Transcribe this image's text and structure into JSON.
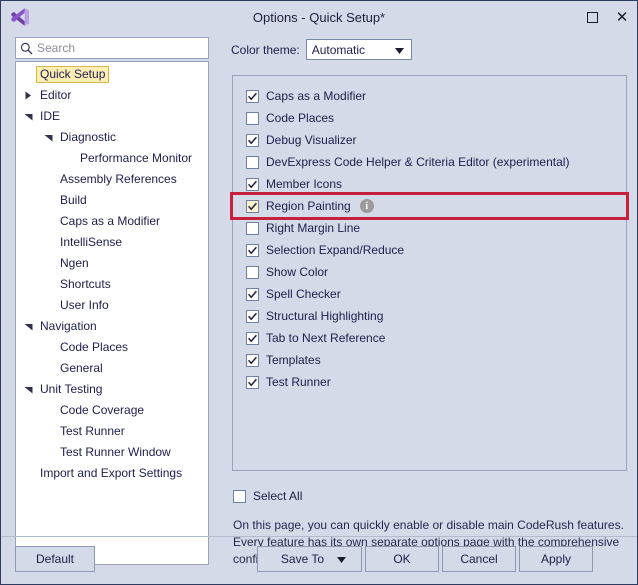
{
  "window": {
    "title": "Options - Quick Setup*",
    "logo_icon": "visual-studio-logo",
    "maximize_label": "Maximize",
    "close_label": "Close"
  },
  "search": {
    "placeholder": "Search",
    "value": "",
    "icon": "search-icon"
  },
  "tree": {
    "items": [
      {
        "label": "Quick Setup",
        "indent": 0,
        "arrow": "none",
        "selected": true
      },
      {
        "label": "Editor",
        "indent": 0,
        "arrow": "collapsed",
        "selected": false
      },
      {
        "label": "IDE",
        "indent": 0,
        "arrow": "expanded",
        "selected": false
      },
      {
        "label": "Diagnostic",
        "indent": 1,
        "arrow": "expanded",
        "selected": false
      },
      {
        "label": "Performance Monitor",
        "indent": 2,
        "arrow": "none",
        "selected": false
      },
      {
        "label": "Assembly References",
        "indent": 1,
        "arrow": "none",
        "selected": false
      },
      {
        "label": "Build",
        "indent": 1,
        "arrow": "none",
        "selected": false
      },
      {
        "label": "Caps as a Modifier",
        "indent": 1,
        "arrow": "none",
        "selected": false
      },
      {
        "label": "IntelliSense",
        "indent": 1,
        "arrow": "none",
        "selected": false
      },
      {
        "label": "Ngen",
        "indent": 1,
        "arrow": "none",
        "selected": false
      },
      {
        "label": "Shortcuts",
        "indent": 1,
        "arrow": "none",
        "selected": false
      },
      {
        "label": "User Info",
        "indent": 1,
        "arrow": "none",
        "selected": false
      },
      {
        "label": "Navigation",
        "indent": 0,
        "arrow": "expanded",
        "selected": false
      },
      {
        "label": "Code Places",
        "indent": 1,
        "arrow": "none",
        "selected": false
      },
      {
        "label": "General",
        "indent": 1,
        "arrow": "none",
        "selected": false
      },
      {
        "label": "Unit Testing",
        "indent": 0,
        "arrow": "expanded",
        "selected": false
      },
      {
        "label": "Code Coverage",
        "indent": 1,
        "arrow": "none",
        "selected": false
      },
      {
        "label": "Test Runner",
        "indent": 1,
        "arrow": "none",
        "selected": false
      },
      {
        "label": "Test Runner Window",
        "indent": 1,
        "arrow": "none",
        "selected": false
      },
      {
        "label": "Import and Export Settings",
        "indent": 0,
        "arrow": "none",
        "selected": false
      }
    ]
  },
  "theme": {
    "label": "Color theme:",
    "value": "Automatic",
    "caret_icon": "chevron-down-icon"
  },
  "options": {
    "items": [
      {
        "label": "Caps as a Modifier",
        "checked": true,
        "marked": false,
        "info": false
      },
      {
        "label": "Code Places",
        "checked": false,
        "marked": false,
        "info": false
      },
      {
        "label": "Debug Visualizer",
        "checked": true,
        "marked": false,
        "info": false
      },
      {
        "label": "DevExpress Code Helper & Criteria Editor (experimental)",
        "checked": false,
        "marked": false,
        "info": false
      },
      {
        "label": "Member Icons",
        "checked": true,
        "marked": false,
        "info": false
      },
      {
        "label": "Region Painting",
        "checked": true,
        "marked": true,
        "info": true
      },
      {
        "label": "Right Margin Line",
        "checked": false,
        "marked": false,
        "info": false
      },
      {
        "label": "Selection Expand/Reduce",
        "checked": true,
        "marked": false,
        "info": false
      },
      {
        "label": "Show Color",
        "checked": false,
        "marked": false,
        "info": false
      },
      {
        "label": "Spell Checker",
        "checked": true,
        "marked": false,
        "info": false
      },
      {
        "label": "Structural Highlighting",
        "checked": true,
        "marked": false,
        "info": false
      },
      {
        "label": "Tab to Next Reference",
        "checked": true,
        "marked": false,
        "info": false
      },
      {
        "label": "Templates",
        "checked": true,
        "marked": false,
        "info": false
      },
      {
        "label": "Test Runner",
        "checked": true,
        "marked": false,
        "info": false
      }
    ],
    "info_glyph": "i",
    "highlight_color": "#c8203c"
  },
  "select_all": {
    "label": "Select All",
    "checked": false
  },
  "description": "On this page, you can quickly enable or disable main CodeRush features. Every feature has its own separate options page with the comprehensive configuration.",
  "footer": {
    "default_label": "Default",
    "save_to_label": "Save To",
    "ok_label": "OK",
    "cancel_label": "Cancel",
    "apply_label": "Apply"
  }
}
